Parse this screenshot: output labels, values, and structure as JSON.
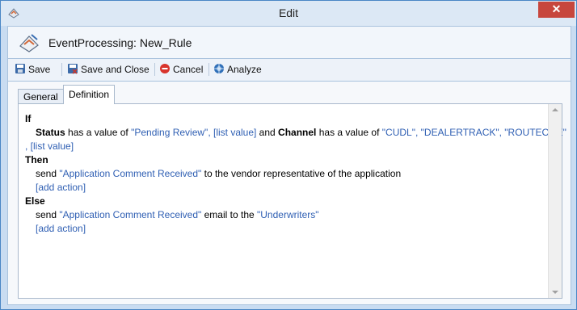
{
  "window": {
    "title": "Edit",
    "close_glyph": "✕"
  },
  "header": {
    "title": "EventProcessing: New_Rule"
  },
  "toolbar": {
    "save": "Save",
    "save_close": "Save and Close",
    "cancel": "Cancel",
    "analyze": "Analyze"
  },
  "tabs": [
    {
      "label": "General"
    },
    {
      "label": "Definition"
    }
  ],
  "rule": {
    "if": "If",
    "cond_field1": "Status",
    "cond_has1": " has a value of ",
    "cond_values1": "\"Pending Review\", [list value]",
    "cond_and": " and ",
    "cond_field2": "Channel",
    "cond_has2": " has a value of ",
    "cond_values2": "\"CUDL\", \"DEALERTRACK\", \"ROUTEONE\"",
    "cond_cont": ", [list value]",
    "then": "Then",
    "then_send": "send ",
    "then_msg": "\"Application Comment Received\"",
    "then_rest": " to the vendor representative of the application",
    "add_action": "[add action]",
    "else": "Else",
    "else_send": "send ",
    "else_msg": "\"Application Comment Received\"",
    "else_mid": " email to the ",
    "else_target": "\"Underwriters\""
  },
  "colors": {
    "link": "#2f5fb3",
    "close": "#c7463d",
    "frame": "#4a86c5"
  },
  "icons": [
    "app-icon",
    "rule-icon",
    "save-icon",
    "save-close-icon",
    "cancel-icon",
    "analyze-icon",
    "close-icon"
  ]
}
